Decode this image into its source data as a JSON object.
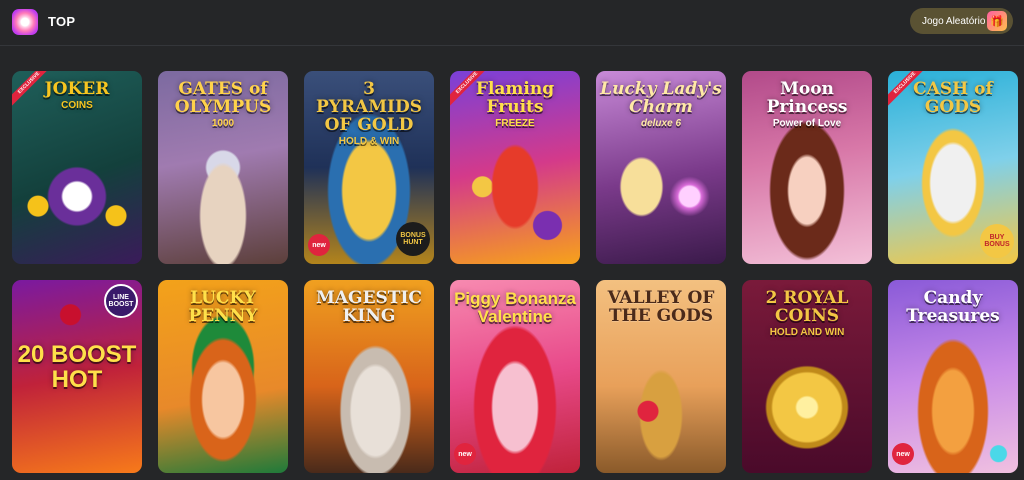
{
  "header": {
    "title": "TOP",
    "random_button_label": "Jogo Aleatório",
    "logo_icon": "brand-logo-icon",
    "random_icon": "dice-gift-icon"
  },
  "badges": {
    "new": "new",
    "exclusive": "EXCLUSIVE",
    "line_boost": "LINE BOOST",
    "buy_bonus": "BUY BONUS",
    "bonus_hunt": "BONUS HUNT"
  },
  "games": [
    {
      "title": "JOKER",
      "sub": "COINS"
    },
    {
      "title": "GATES of OLYMPUS",
      "sub": "1000"
    },
    {
      "title": "3 PYRAMIDS OF GOLD",
      "sub": "HOLD & WIN"
    },
    {
      "title": "Flaming Fruits",
      "sub": "FREEZE"
    },
    {
      "title": "Lucky Lady's Charm",
      "sub": "deluxe 6"
    },
    {
      "title": "Moon Princess",
      "sub": "Power of Love"
    },
    {
      "title": "CASH of GODS",
      "sub": ""
    },
    {
      "title": "20 BOOST HOT",
      "sub": ""
    },
    {
      "title": "LUCKY PENNY",
      "sub": ""
    },
    {
      "title": "MAGESTIC KING",
      "sub": ""
    },
    {
      "title": "Piggy Bonanza Valentine",
      "sub": ""
    },
    {
      "title": "VALLEY OF THE GODS",
      "sub": ""
    },
    {
      "title": "2 ROYAL COINS",
      "sub": "HOLD AND WIN"
    },
    {
      "title": "Candy Treasures",
      "sub": ""
    }
  ]
}
